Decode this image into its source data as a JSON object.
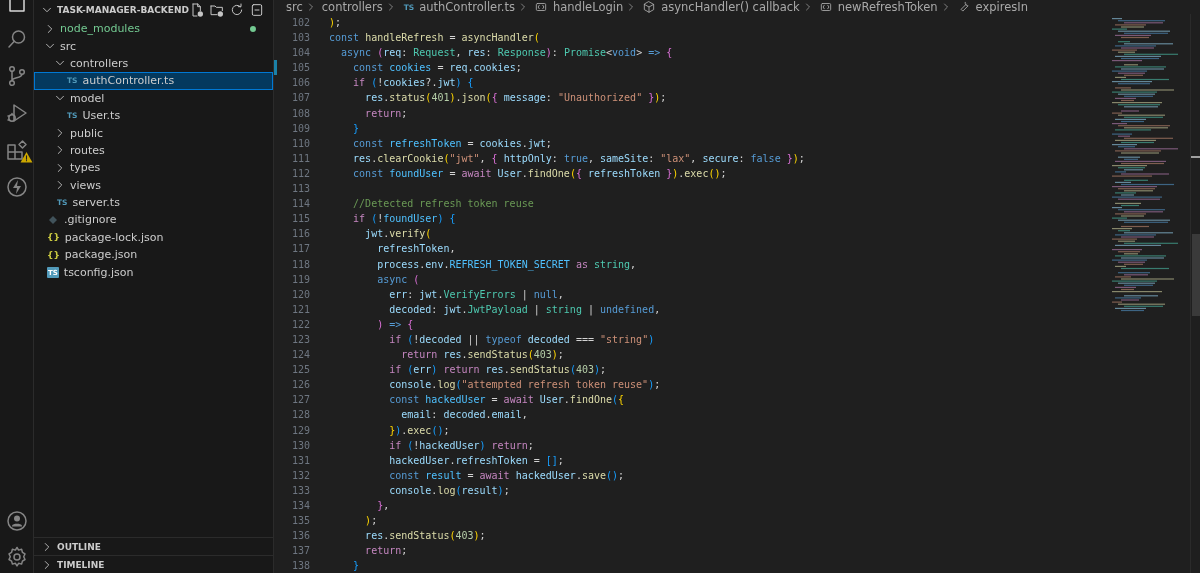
{
  "activity_bar": {
    "top": [
      {
        "kind": "explorer",
        "selected": true,
        "warning": false
      },
      {
        "kind": "search",
        "selected": false,
        "warning": false
      },
      {
        "kind": "source-control",
        "selected": false,
        "warning": false
      },
      {
        "kind": "run-debug",
        "selected": false,
        "warning": false
      },
      {
        "kind": "extensions",
        "selected": false,
        "warning": true
      },
      {
        "kind": "lightning",
        "selected": false,
        "warning": false
      }
    ],
    "bottom": [
      {
        "kind": "account"
      },
      {
        "kind": "settings"
      }
    ]
  },
  "explorer": {
    "title": "TASK-MANAGER-BACKEND",
    "tree": [
      {
        "label": "node_modules",
        "kind": "folder",
        "expanded": false,
        "selected": false,
        "color": "#73c991"
      },
      {
        "label": "src",
        "kind": "folder",
        "expanded": true,
        "selected": false,
        "children": [
          {
            "label": "controllers",
            "kind": "folder",
            "expanded": true,
            "selected": false,
            "children": [
              {
                "label": "authController.ts",
                "kind": "ts",
                "badge": "TS",
                "selected": true
              }
            ]
          },
          {
            "label": "model",
            "kind": "folder",
            "expanded": true,
            "selected": false,
            "children": [
              {
                "label": "User.ts",
                "kind": "ts",
                "badge": "TS",
                "selected": false
              }
            ]
          },
          {
            "label": "public",
            "kind": "folder",
            "expanded": false,
            "selected": false
          },
          {
            "label": "routes",
            "kind": "folder",
            "expanded": false,
            "selected": false
          },
          {
            "label": "types",
            "kind": "folder",
            "expanded": false,
            "selected": false
          },
          {
            "label": "views",
            "kind": "folder",
            "expanded": false,
            "selected": false
          },
          {
            "label": "server.ts",
            "kind": "ts",
            "badge": "TS",
            "selected": false
          }
        ]
      },
      {
        "label": ".gitignore",
        "kind": "git",
        "selected": false
      },
      {
        "label": "package-lock.json",
        "kind": "json",
        "badge": "{}",
        "selected": false
      },
      {
        "label": "package.json",
        "kind": "json",
        "badge": "{}",
        "selected": false
      },
      {
        "label": "tsconfig.json",
        "kind": "tsconfig",
        "badge": "TS",
        "selected": false
      }
    ],
    "sections": [
      {
        "label": "OUTLINE",
        "expanded": false
      },
      {
        "label": "TIMELINE",
        "expanded": false
      }
    ]
  },
  "breadcrumbs": [
    {
      "label": "src",
      "kind": "folder"
    },
    {
      "label": "controllers",
      "kind": "folder"
    },
    {
      "label": "authController.ts",
      "kind": "ts",
      "badge": "TS"
    },
    {
      "label": "handleLogin",
      "kind": "variable"
    },
    {
      "label": "asyncHandler() callback",
      "kind": "method"
    },
    {
      "label": "newRefreshToken",
      "kind": "variable"
    },
    {
      "label": "expiresIn",
      "kind": "property"
    }
  ],
  "lines": [
    {
      "number": "102",
      "modified": false,
      "tokens": [
        {
          "text": ")",
          "kind": "b1"
        },
        {
          "text": ";",
          "kind": "p"
        }
      ]
    },
    {
      "number": "103",
      "modified": false,
      "tokens": [
        {
          "text": "const",
          "kind": "k"
        },
        {
          "text": " handleRefresh",
          "kind": "f"
        },
        {
          "text": " = ",
          "kind": "p"
        },
        {
          "text": "asyncHandler",
          "kind": "f"
        },
        {
          "text": "(",
          "kind": "b1"
        }
      ]
    },
    {
      "number": "104",
      "modified": false,
      "tokens": [
        {
          "text": "  async",
          "kind": "k"
        },
        {
          "text": " (",
          "kind": "b2"
        },
        {
          "text": "req",
          "kind": "v"
        },
        {
          "text": ": ",
          "kind": "p"
        },
        {
          "text": "Request",
          "kind": "t"
        },
        {
          "text": ", ",
          "kind": "p"
        },
        {
          "text": "res",
          "kind": "v"
        },
        {
          "text": ": ",
          "kind": "p"
        },
        {
          "text": "Response",
          "kind": "t"
        },
        {
          "text": ")",
          "kind": "b2"
        },
        {
          "text": ": ",
          "kind": "p"
        },
        {
          "text": "Promise",
          "kind": "t"
        },
        {
          "text": "<",
          "kind": "p"
        },
        {
          "text": "void",
          "kind": "k"
        },
        {
          "text": ">",
          "kind": "p"
        },
        {
          "text": " => ",
          "kind": "k"
        },
        {
          "text": "{",
          "kind": "b2"
        }
      ]
    },
    {
      "number": "105",
      "modified": true,
      "tokens": [
        {
          "text": "    const",
          "kind": "k"
        },
        {
          "text": " cookies",
          "kind": "co"
        },
        {
          "text": " = ",
          "kind": "p"
        },
        {
          "text": "req",
          "kind": "v"
        },
        {
          "text": ".",
          "kind": "p"
        },
        {
          "text": "cookies",
          "kind": "v"
        },
        {
          "text": ";",
          "kind": "p"
        }
      ]
    },
    {
      "number": "106",
      "modified": false,
      "tokens": [
        {
          "text": "    if",
          "kind": "c"
        },
        {
          "text": " (",
          "kind": "b3"
        },
        {
          "text": "!",
          "kind": "p"
        },
        {
          "text": "cookies",
          "kind": "v"
        },
        {
          "text": "?.",
          "kind": "p"
        },
        {
          "text": "jwt",
          "kind": "v"
        },
        {
          "text": ")",
          "kind": "b3"
        },
        {
          "text": " {",
          "kind": "b3"
        }
      ]
    },
    {
      "number": "107",
      "modified": false,
      "tokens": [
        {
          "text": "      res",
          "kind": "v"
        },
        {
          "text": ".",
          "kind": "p"
        },
        {
          "text": "status",
          "kind": "f"
        },
        {
          "text": "(",
          "kind": "b1"
        },
        {
          "text": "401",
          "kind": "n"
        },
        {
          "text": ")",
          "kind": "b1"
        },
        {
          "text": ".",
          "kind": "p"
        },
        {
          "text": "json",
          "kind": "f"
        },
        {
          "text": "(",
          "kind": "b1"
        },
        {
          "text": "{",
          "kind": "b2"
        },
        {
          "text": " message",
          "kind": "v"
        },
        {
          "text": ": ",
          "kind": "p"
        },
        {
          "text": "\"Unauthorized\"",
          "kind": "s"
        },
        {
          "text": " }",
          "kind": "b2"
        },
        {
          "text": ")",
          "kind": "b1"
        },
        {
          "text": ";",
          "kind": "p"
        }
      ]
    },
    {
      "number": "108",
      "modified": false,
      "tokens": [
        {
          "text": "      return",
          "kind": "c"
        },
        {
          "text": ";",
          "kind": "p"
        }
      ]
    },
    {
      "number": "109",
      "modified": false,
      "tokens": [
        {
          "text": "    }",
          "kind": "b3"
        }
      ]
    },
    {
      "number": "110",
      "modified": false,
      "tokens": [
        {
          "text": "    const",
          "kind": "k"
        },
        {
          "text": " refreshToken",
          "kind": "co"
        },
        {
          "text": " = ",
          "kind": "p"
        },
        {
          "text": "cookies",
          "kind": "v"
        },
        {
          "text": ".",
          "kind": "p"
        },
        {
          "text": "jwt",
          "kind": "v"
        },
        {
          "text": ";",
          "kind": "p"
        }
      ]
    },
    {
      "number": "111",
      "modified": false,
      "tokens": [
        {
          "text": "    res",
          "kind": "v"
        },
        {
          "text": ".",
          "kind": "p"
        },
        {
          "text": "clearCookie",
          "kind": "f"
        },
        {
          "text": "(",
          "kind": "b1"
        },
        {
          "text": "\"jwt\"",
          "kind": "s"
        },
        {
          "text": ", ",
          "kind": "p"
        },
        {
          "text": "{",
          "kind": "b2"
        },
        {
          "text": " httpOnly",
          "kind": "v"
        },
        {
          "text": ": ",
          "kind": "p"
        },
        {
          "text": "true",
          "kind": "k"
        },
        {
          "text": ", ",
          "kind": "p"
        },
        {
          "text": "sameSite",
          "kind": "v"
        },
        {
          "text": ": ",
          "kind": "p"
        },
        {
          "text": "\"lax\"",
          "kind": "s"
        },
        {
          "text": ", ",
          "kind": "p"
        },
        {
          "text": "secure",
          "kind": "v"
        },
        {
          "text": ": ",
          "kind": "p"
        },
        {
          "text": "false",
          "kind": "k"
        },
        {
          "text": " }",
          "kind": "b2"
        },
        {
          "text": ")",
          "kind": "b1"
        },
        {
          "text": ";",
          "kind": "p"
        }
      ]
    },
    {
      "number": "112",
      "modified": false,
      "tokens": [
        {
          "text": "    const",
          "kind": "k"
        },
        {
          "text": " foundUser",
          "kind": "co"
        },
        {
          "text": " = ",
          "kind": "p"
        },
        {
          "text": "await",
          "kind": "c"
        },
        {
          "text": " User",
          "kind": "v"
        },
        {
          "text": ".",
          "kind": "p"
        },
        {
          "text": "findOne",
          "kind": "f"
        },
        {
          "text": "(",
          "kind": "b1"
        },
        {
          "text": "{",
          "kind": "b2"
        },
        {
          "text": " refreshToken",
          "kind": "v"
        },
        {
          "text": " }",
          "kind": "b2"
        },
        {
          "text": ")",
          "kind": "b1"
        },
        {
          "text": ".",
          "kind": "p"
        },
        {
          "text": "exec",
          "kind": "f"
        },
        {
          "text": "()",
          "kind": "b1"
        },
        {
          "text": ";",
          "kind": "p"
        }
      ]
    },
    {
      "number": "113",
      "modified": false
    },
    {
      "number": "114",
      "modified": false,
      "tokens": [
        {
          "text": "    //Detected refresh token reuse",
          "kind": "m"
        }
      ]
    },
    {
      "number": "115",
      "modified": false,
      "tokens": [
        {
          "text": "    if",
          "kind": "c"
        },
        {
          "text": " (",
          "kind": "b3"
        },
        {
          "text": "!",
          "kind": "p"
        },
        {
          "text": "foundUser",
          "kind": "co"
        },
        {
          "text": ")",
          "kind": "b3"
        },
        {
          "text": " {",
          "kind": "b3"
        }
      ]
    },
    {
      "number": "116",
      "modified": false,
      "tokens": [
        {
          "text": "      jwt",
          "kind": "v"
        },
        {
          "text": ".",
          "kind": "p"
        },
        {
          "text": "verify",
          "kind": "f"
        },
        {
          "text": "(",
          "kind": "b1"
        }
      ]
    },
    {
      "number": "117",
      "modified": false,
      "tokens": [
        {
          "text": "        refreshToken",
          "kind": "v"
        },
        {
          "text": ",",
          "kind": "p"
        }
      ]
    },
    {
      "number": "118",
      "modified": false,
      "tokens": [
        {
          "text": "        process",
          "kind": "v"
        },
        {
          "text": ".",
          "kind": "p"
        },
        {
          "text": "env",
          "kind": "v"
        },
        {
          "text": ".",
          "kind": "p"
        },
        {
          "text": "REFRESH_TOKEN_SECRET",
          "kind": "co"
        },
        {
          "text": " as",
          "kind": "c"
        },
        {
          "text": " string",
          "kind": "t"
        },
        {
          "text": ",",
          "kind": "p"
        }
      ]
    },
    {
      "number": "119",
      "modified": false,
      "tokens": [
        {
          "text": "        async",
          "kind": "k"
        },
        {
          "text": " (",
          "kind": "b2"
        }
      ]
    },
    {
      "number": "120",
      "modified": false,
      "tokens": [
        {
          "text": "          err",
          "kind": "v"
        },
        {
          "text": ": ",
          "kind": "p"
        },
        {
          "text": "jwt",
          "kind": "v"
        },
        {
          "text": ".",
          "kind": "p"
        },
        {
          "text": "VerifyErrors",
          "kind": "t"
        },
        {
          "text": " | ",
          "kind": "p"
        },
        {
          "text": "null",
          "kind": "k"
        },
        {
          "text": ",",
          "kind": "p"
        }
      ]
    },
    {
      "number": "121",
      "modified": false,
      "tokens": [
        {
          "text": "          decoded",
          "kind": "v"
        },
        {
          "text": ": ",
          "kind": "p"
        },
        {
          "text": "jwt",
          "kind": "v"
        },
        {
          "text": ".",
          "kind": "p"
        },
        {
          "text": "JwtPayload",
          "kind": "t"
        },
        {
          "text": " | ",
          "kind": "p"
        },
        {
          "text": "string",
          "kind": "t"
        },
        {
          "text": " | ",
          "kind": "p"
        },
        {
          "text": "undefined",
          "kind": "k"
        },
        {
          "text": ",",
          "kind": "p"
        }
      ]
    },
    {
      "number": "122",
      "modified": false,
      "tokens": [
        {
          "text": "        )",
          "kind": "b2"
        },
        {
          "text": " => ",
          "kind": "k"
        },
        {
          "text": "{",
          "kind": "b2"
        }
      ]
    },
    {
      "number": "123",
      "modified": false,
      "tokens": [
        {
          "text": "          if",
          "kind": "c"
        },
        {
          "text": " (",
          "kind": "b3"
        },
        {
          "text": "!",
          "kind": "p"
        },
        {
          "text": "decoded",
          "kind": "v"
        },
        {
          "text": " || ",
          "kind": "p"
        },
        {
          "text": "typeof",
          "kind": "k"
        },
        {
          "text": " decoded",
          "kind": "v"
        },
        {
          "text": " === ",
          "kind": "p"
        },
        {
          "text": "\"string\"",
          "kind": "s"
        },
        {
          "text": ")",
          "kind": "b3"
        }
      ]
    },
    {
      "number": "124",
      "modified": false,
      "tokens": [
        {
          "text": "            return",
          "kind": "c"
        },
        {
          "text": " res",
          "kind": "v"
        },
        {
          "text": ".",
          "kind": "p"
        },
        {
          "text": "sendStatus",
          "kind": "f"
        },
        {
          "text": "(",
          "kind": "b1"
        },
        {
          "text": "403",
          "kind": "n"
        },
        {
          "text": ")",
          "kind": "b1"
        },
        {
          "text": ";",
          "kind": "p"
        }
      ]
    },
    {
      "number": "125",
      "modified": false,
      "tokens": [
        {
          "text": "          if",
          "kind": "c"
        },
        {
          "text": " (",
          "kind": "b3"
        },
        {
          "text": "err",
          "kind": "v"
        },
        {
          "text": ")",
          "kind": "b3"
        },
        {
          "text": " return",
          "kind": "c"
        },
        {
          "text": " res",
          "kind": "v"
        },
        {
          "text": ".",
          "kind": "p"
        },
        {
          "text": "sendStatus",
          "kind": "f"
        },
        {
          "text": "(",
          "kind": "b3"
        },
        {
          "text": "403",
          "kind": "n"
        },
        {
          "text": ")",
          "kind": "b3"
        },
        {
          "text": ";",
          "kind": "p"
        }
      ]
    },
    {
      "number": "126",
      "modified": false,
      "tokens": [
        {
          "text": "          console",
          "kind": "v"
        },
        {
          "text": ".",
          "kind": "p"
        },
        {
          "text": "log",
          "kind": "f"
        },
        {
          "text": "(",
          "kind": "b3"
        },
        {
          "text": "\"attempted refresh token reuse\"",
          "kind": "s"
        },
        {
          "text": ")",
          "kind": "b3"
        },
        {
          "text": ";",
          "kind": "p"
        }
      ]
    },
    {
      "number": "127",
      "modified": false,
      "tokens": [
        {
          "text": "          const",
          "kind": "k"
        },
        {
          "text": " hackedUser",
          "kind": "co"
        },
        {
          "text": " = ",
          "kind": "p"
        },
        {
          "text": "await",
          "kind": "c"
        },
        {
          "text": " User",
          "kind": "v"
        },
        {
          "text": ".",
          "kind": "p"
        },
        {
          "text": "findOne",
          "kind": "f"
        },
        {
          "text": "(",
          "kind": "b3"
        },
        {
          "text": "{",
          "kind": "b1"
        }
      ]
    },
    {
      "number": "128",
      "modified": false,
      "tokens": [
        {
          "text": "            email",
          "kind": "v"
        },
        {
          "text": ": ",
          "kind": "p"
        },
        {
          "text": "decoded",
          "kind": "v"
        },
        {
          "text": ".",
          "kind": "p"
        },
        {
          "text": "email",
          "kind": "v"
        },
        {
          "text": ",",
          "kind": "p"
        }
      ]
    },
    {
      "number": "129",
      "modified": false,
      "tokens": [
        {
          "text": "          }",
          "kind": "b1"
        },
        {
          "text": ")",
          "kind": "b3"
        },
        {
          "text": ".",
          "kind": "p"
        },
        {
          "text": "exec",
          "kind": "f"
        },
        {
          "text": "()",
          "kind": "b3"
        },
        {
          "text": ";",
          "kind": "p"
        }
      ]
    },
    {
      "number": "130",
      "modified": false,
      "tokens": [
        {
          "text": "          if",
          "kind": "c"
        },
        {
          "text": " (",
          "kind": "b3"
        },
        {
          "text": "!",
          "kind": "p"
        },
        {
          "text": "hackedUser",
          "kind": "v"
        },
        {
          "text": ")",
          "kind": "b3"
        },
        {
          "text": " return",
          "kind": "c"
        },
        {
          "text": ";",
          "kind": "p"
        }
      ]
    },
    {
      "number": "131",
      "modified": false,
      "tokens": [
        {
          "text": "          hackedUser",
          "kind": "v"
        },
        {
          "text": ".",
          "kind": "p"
        },
        {
          "text": "refreshToken",
          "kind": "v"
        },
        {
          "text": " = ",
          "kind": "p"
        },
        {
          "text": "[]",
          "kind": "b3"
        },
        {
          "text": ";",
          "kind": "p"
        }
      ]
    },
    {
      "number": "132",
      "modified": false,
      "tokens": [
        {
          "text": "          const",
          "kind": "k"
        },
        {
          "text": " result",
          "kind": "co"
        },
        {
          "text": " = ",
          "kind": "p"
        },
        {
          "text": "await",
          "kind": "c"
        },
        {
          "text": " hackedUser",
          "kind": "v"
        },
        {
          "text": ".",
          "kind": "p"
        },
        {
          "text": "save",
          "kind": "f"
        },
        {
          "text": "()",
          "kind": "b3"
        },
        {
          "text": ";",
          "kind": "p"
        }
      ]
    },
    {
      "number": "133",
      "modified": false,
      "tokens": [
        {
          "text": "          console",
          "kind": "v"
        },
        {
          "text": ".",
          "kind": "p"
        },
        {
          "text": "log",
          "kind": "f"
        },
        {
          "text": "(",
          "kind": "b3"
        },
        {
          "text": "result",
          "kind": "v"
        },
        {
          "text": ")",
          "kind": "b3"
        },
        {
          "text": ";",
          "kind": "p"
        }
      ]
    },
    {
      "number": "134",
      "modified": false,
      "tokens": [
        {
          "text": "        }",
          "kind": "b2"
        },
        {
          "text": ",",
          "kind": "p"
        }
      ]
    },
    {
      "number": "135",
      "modified": false,
      "tokens": [
        {
          "text": "      )",
          "kind": "b1"
        },
        {
          "text": ";",
          "kind": "p"
        }
      ]
    },
    {
      "number": "136",
      "modified": false,
      "tokens": [
        {
          "text": "      res",
          "kind": "v"
        },
        {
          "text": ".",
          "kind": "p"
        },
        {
          "text": "sendStatus",
          "kind": "f"
        },
        {
          "text": "(",
          "kind": "b1"
        },
        {
          "text": "403",
          "kind": "n"
        },
        {
          "text": ")",
          "kind": "b1"
        },
        {
          "text": ";",
          "kind": "p"
        }
      ]
    },
    {
      "number": "137",
      "modified": false,
      "tokens": [
        {
          "text": "      return",
          "kind": "c"
        },
        {
          "text": ";",
          "kind": "p"
        }
      ]
    },
    {
      "number": "138",
      "modified": false,
      "tokens": [
        {
          "text": "    }",
          "kind": "b3"
        }
      ]
    }
  ]
}
